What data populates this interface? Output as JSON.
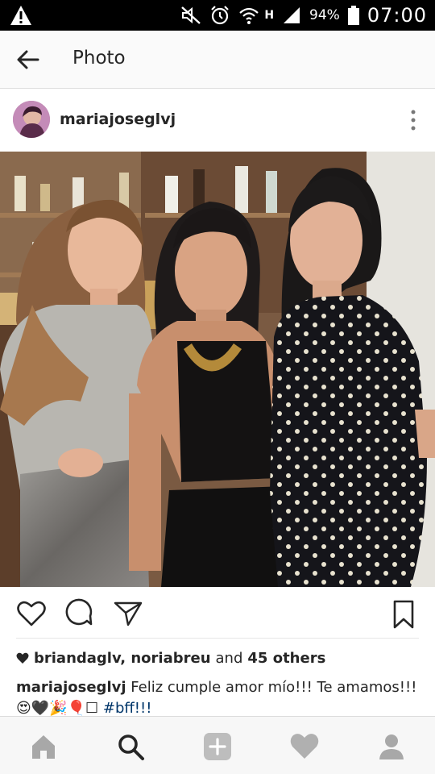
{
  "status_bar": {
    "battery_percent": "94%",
    "time": "07:00",
    "network_type": "H",
    "icons": [
      "warning-icon",
      "mute-icon",
      "alarm-icon",
      "wifi-icon",
      "signal-icon",
      "battery-icon"
    ]
  },
  "app_bar": {
    "title": "Photo",
    "back_icon": "arrow-left-icon"
  },
  "post": {
    "username": "mariajoseglvj",
    "more_icon": "vertical-dots-icon",
    "actions": [
      "heart-icon",
      "comment-icon",
      "send-icon",
      "bookmark-icon"
    ],
    "likes": {
      "names": "briandaglv, noriabreu",
      "connector": "and",
      "others": "45 others"
    },
    "caption": {
      "username": "mariajoseglvj",
      "text": "Feliz cumple amor mío!!! Te amamos!!!",
      "emojis": "😍🖤🎉🎈☐",
      "hashtag": "#bff!!!"
    }
  },
  "bottom_nav": [
    "home-icon",
    "search-icon",
    "add-icon",
    "activity-heart-icon",
    "profile-icon"
  ],
  "colors": {
    "status_bar_bg": "#000000",
    "app_bar_bg": "#fafafa",
    "text": "#262626",
    "hashtag": "#003569",
    "nav_inactive": "#a8a8a8",
    "nav_active": "#262626"
  }
}
